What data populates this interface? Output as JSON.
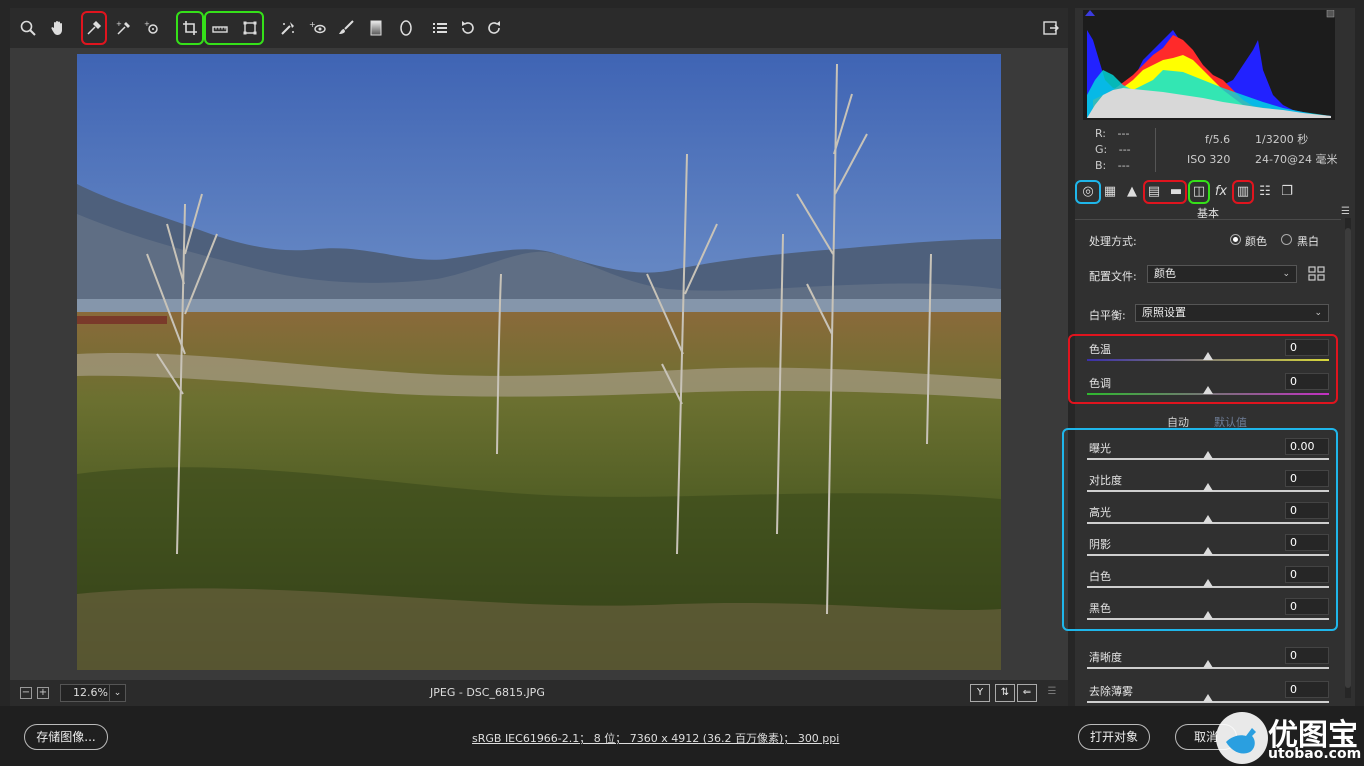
{
  "toolbar": {
    "tools": [
      "zoom-icon",
      "hand-icon",
      "white-balance-icon",
      "color-sampler-icon",
      "targeted-adjustment-icon",
      "crop-icon",
      "straighten-icon",
      "transform-icon",
      "spot-removal-icon",
      "red-eye-icon",
      "adjustment-brush-icon",
      "graduated-filter-icon",
      "radial-filter-icon",
      "presets-list-icon",
      "rotate-left-icon",
      "rotate-right-icon"
    ],
    "open_preferences_icon": "export-icon"
  },
  "status": {
    "zoom_value": "12.6%",
    "filename": "JPEG - DSC_6815.JPG"
  },
  "bottom": {
    "save_label": "存储图像...",
    "workflow_text": "sRGB IEC61966-2.1； 8 位； 7360 x 4912 (36.2 百万像素)； 300 ppi",
    "open_label": "打开对象",
    "cancel_label": "取消"
  },
  "meta": {
    "r_label": "R:",
    "r_value": "---",
    "g_label": "G:",
    "g_value": "---",
    "b_label": "B:",
    "b_value": "---",
    "aperture": "f/5.6",
    "shutter": "1/3200 秒",
    "iso": "ISO 320",
    "lens": "24-70@24 毫米"
  },
  "panel": {
    "section_title": "基本",
    "treatment_label": "处理方式:",
    "treatment_color": "颜色",
    "treatment_bw": "黑白",
    "profile_label": "配置文件:",
    "profile_value": "颜色",
    "wb_label": "白平衡:",
    "wb_value": "原照设置",
    "auto_label": "自动",
    "default_label": "默认值",
    "sliders": [
      {
        "label": "色温",
        "value": "0",
        "position": 0.5
      },
      {
        "label": "色调",
        "value": "0",
        "position": 0.5
      },
      {
        "label": "曝光",
        "value": "0.00",
        "position": 0.5
      },
      {
        "label": "对比度",
        "value": "0",
        "position": 0.5
      },
      {
        "label": "高光",
        "value": "0",
        "position": 0.5
      },
      {
        "label": "阴影",
        "value": "0",
        "position": 0.5
      },
      {
        "label": "白色",
        "value": "0",
        "position": 0.5
      },
      {
        "label": "黑色",
        "value": "0",
        "position": 0.5
      },
      {
        "label": "清晰度",
        "value": "0",
        "position": 0.5
      },
      {
        "label": "去除薄雾",
        "value": "0",
        "position": 0.5
      }
    ]
  },
  "watermark": {
    "brand": "优图宝",
    "url": "utobao.com"
  },
  "colors": {
    "highlight_red": "#e0141e",
    "highlight_green": "#35e019",
    "highlight_blue": "#1fb6ea"
  }
}
